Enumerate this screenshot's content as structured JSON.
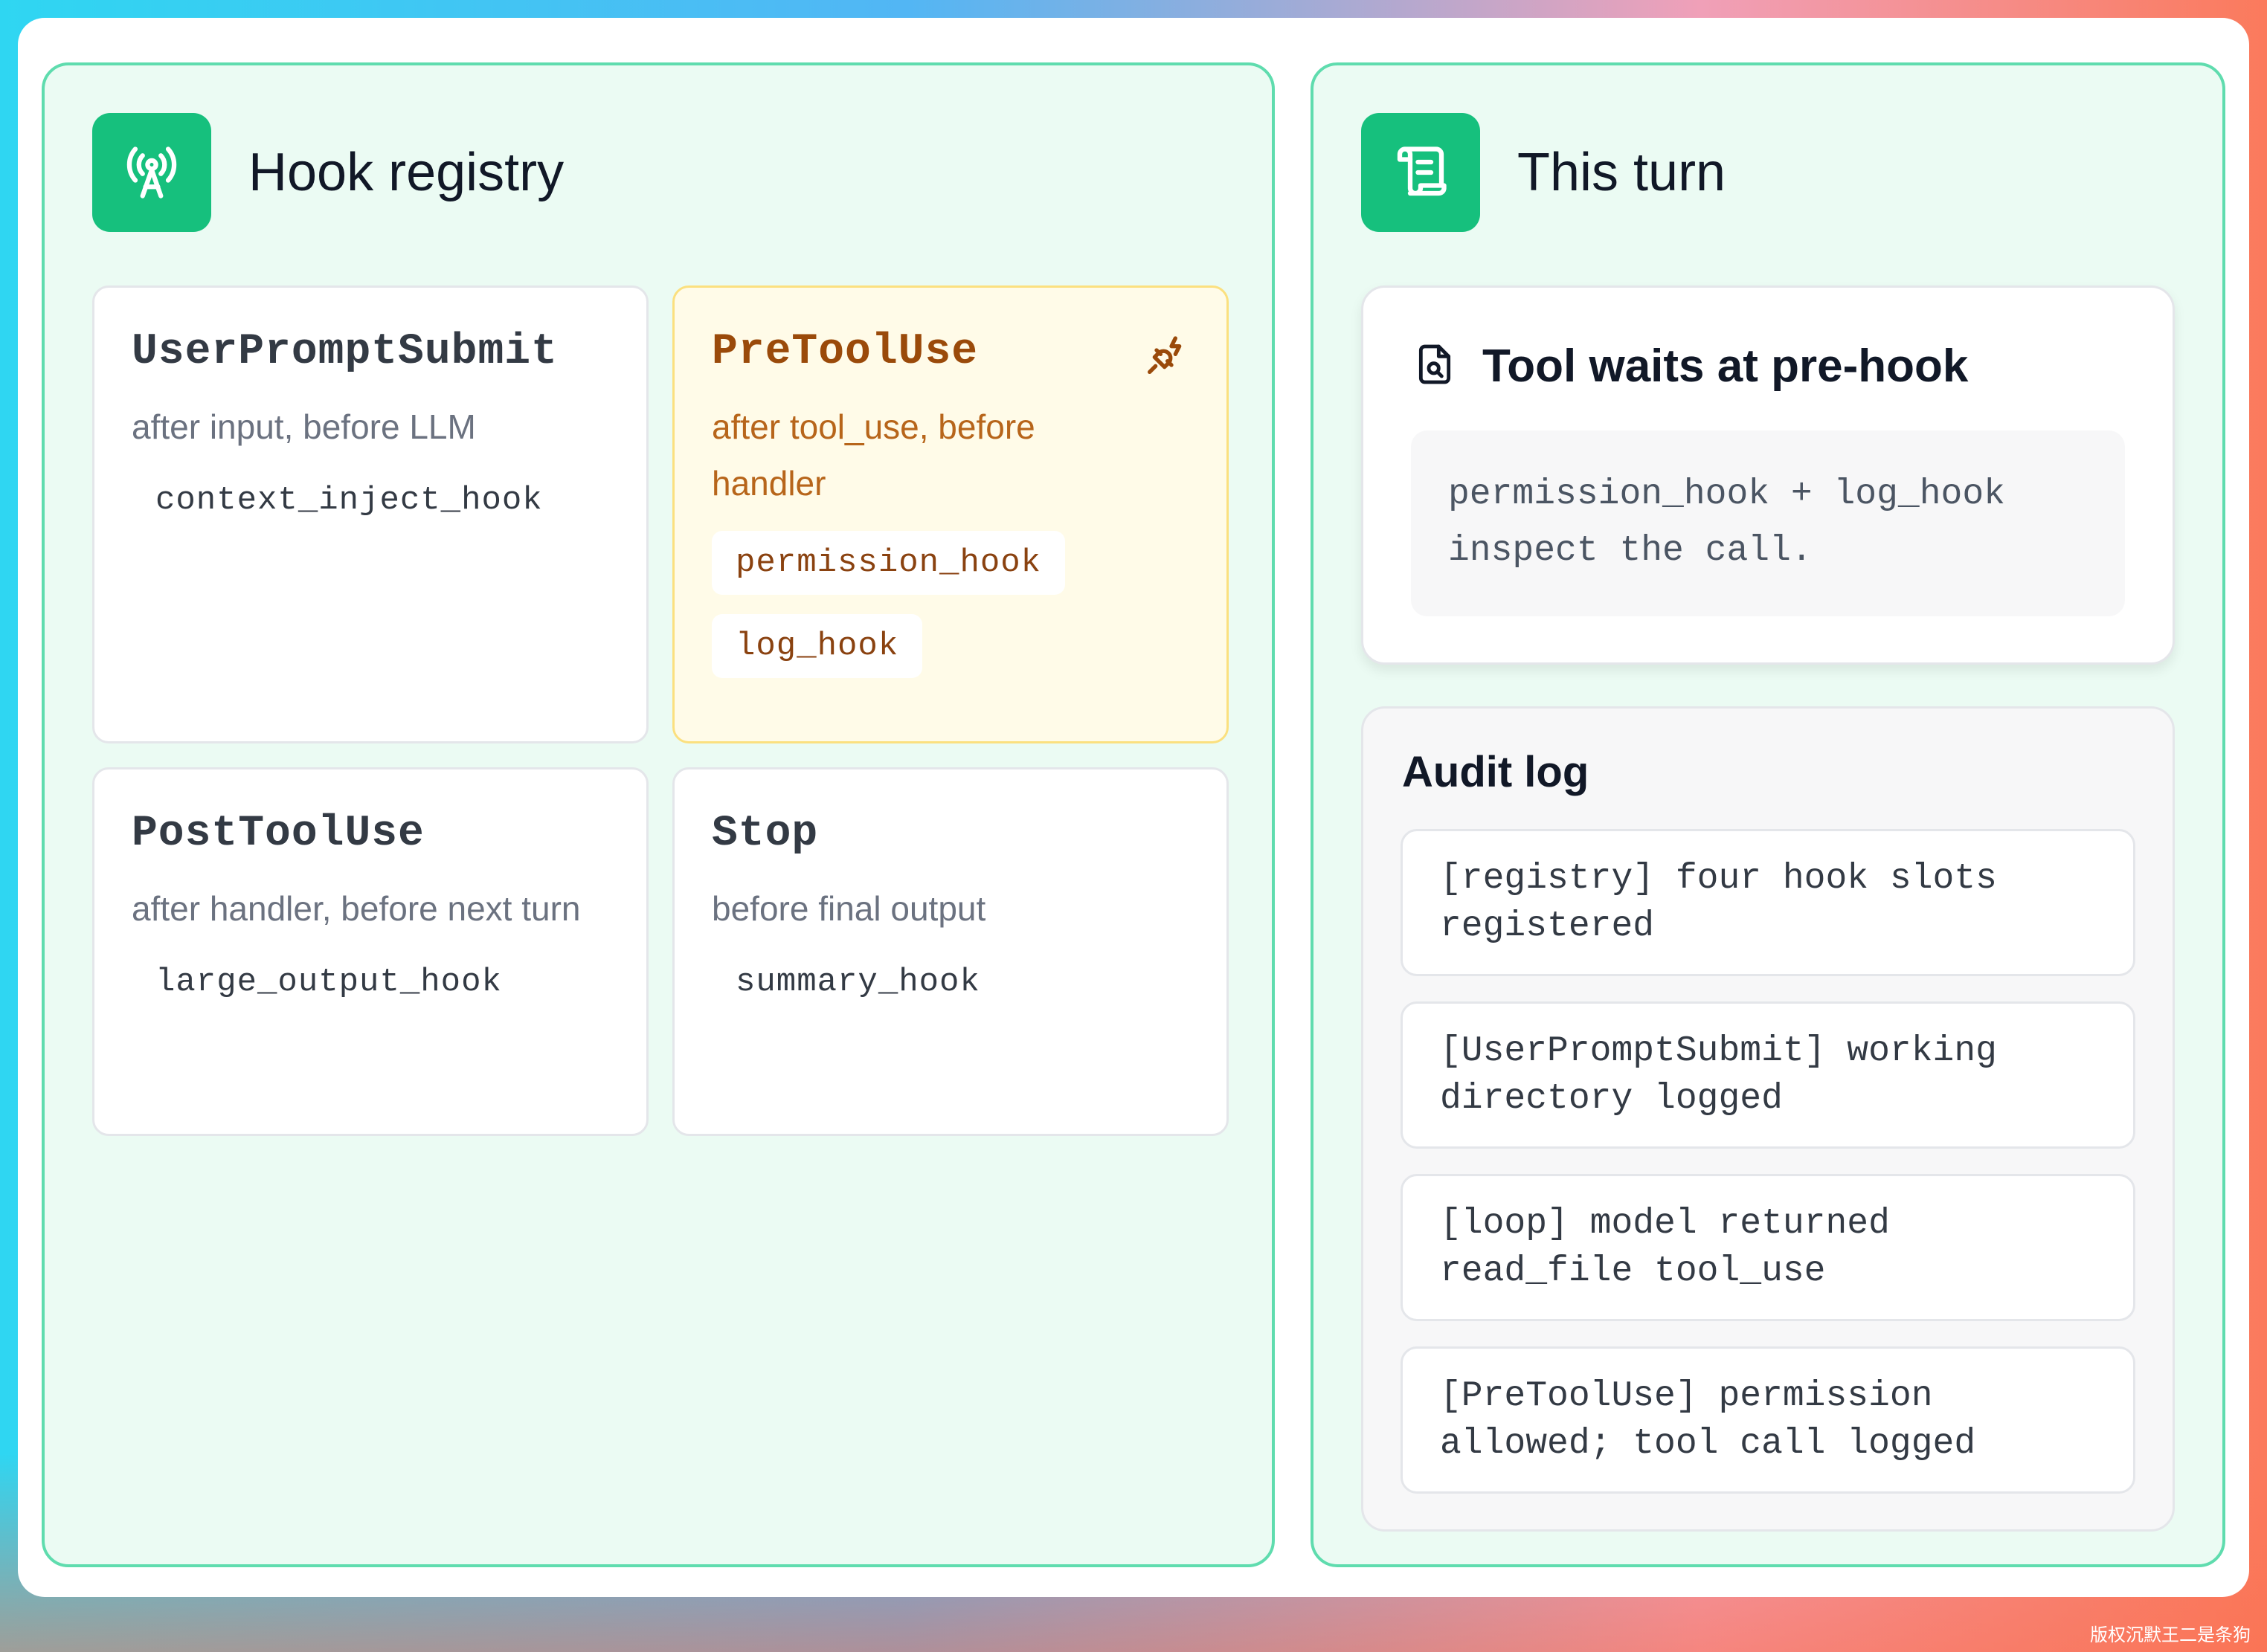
{
  "registry": {
    "title": "Hook registry",
    "icon": "broadcast-antenna-icon",
    "slots": [
      {
        "name": "UserPromptSubmit",
        "desc": "after input, before LLM",
        "hooks": [
          "context_inject_hook"
        ],
        "active": false
      },
      {
        "name": "PreToolUse",
        "desc": "after tool_use, before handler",
        "hooks": [
          "permission_hook",
          "log_hook"
        ],
        "active": true,
        "icon": "plug-icon"
      },
      {
        "name": "PostToolUse",
        "desc": "after handler, before next turn",
        "hooks": [
          "large_output_hook"
        ],
        "active": false
      },
      {
        "name": "Stop",
        "desc": "before final output",
        "hooks": [
          "summary_hook"
        ],
        "active": false
      }
    ]
  },
  "turn": {
    "title": "This turn",
    "icon": "scroll-icon",
    "status_card": {
      "icon": "file-search-icon",
      "title": "Tool waits at pre-hook",
      "body": "permission_hook + log_hook inspect the call."
    },
    "audit": {
      "title": "Audit log",
      "entries": [
        "[registry] four hook slots registered",
        "[UserPromptSubmit] working directory logged",
        "[loop] model returned read_file tool_use",
        "[PreToolUse] permission allowed; tool call logged"
      ]
    }
  },
  "colors": {
    "accent": "#16c07d",
    "panel_bg": "#ebfbf3",
    "panel_border": "#5fdcae",
    "active_bg": "#fffbe8",
    "active_text": "#9a4a0a"
  },
  "watermark": "版权沉默王二是条狗"
}
